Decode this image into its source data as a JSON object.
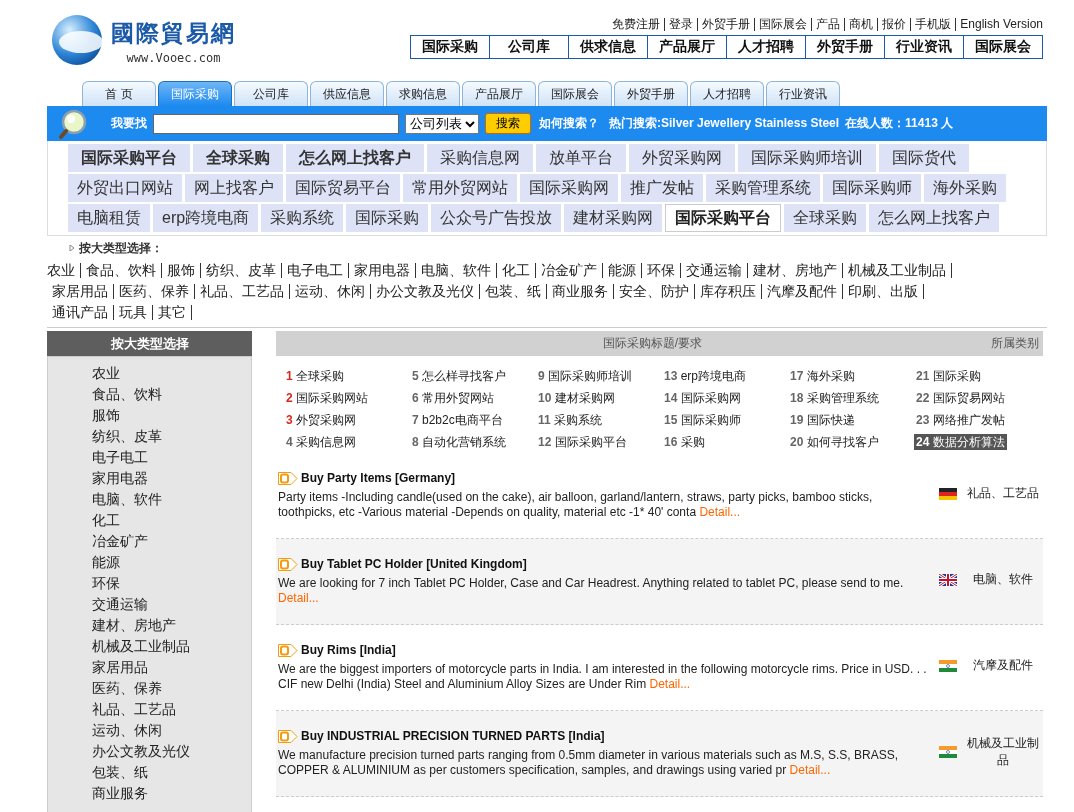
{
  "logo": {
    "title": "國際貿易網",
    "url": "www.Vooec.com"
  },
  "top_links": [
    "免费注册",
    "登录",
    "外贸手册",
    "国际展会",
    "产品",
    "商机",
    "报价",
    "手机版",
    "English Version"
  ],
  "main_nav": [
    "国际采购",
    "公司库",
    "供求信息",
    "产品展厅",
    "人才招聘",
    "外贸手册",
    "行业资讯",
    "国际展会"
  ],
  "tabs": [
    {
      "label": "首 页",
      "selected": false
    },
    {
      "label": "国际采购",
      "selected": true
    },
    {
      "label": "公司库",
      "selected": false
    },
    {
      "label": "供应信息",
      "selected": false
    },
    {
      "label": "求购信息",
      "selected": false
    },
    {
      "label": "产品展厅",
      "selected": false
    },
    {
      "label": "国际展会",
      "selected": false
    },
    {
      "label": "外贸手册",
      "selected": false
    },
    {
      "label": "人才招聘",
      "selected": false
    },
    {
      "label": "行业资讯",
      "selected": false
    }
  ],
  "search": {
    "label": "我要找",
    "select": "公司列表",
    "button": "搜索",
    "help": "如何搜索？",
    "hot": "热门搜索:Silver Jewellery  Stainless Steel",
    "online": "在线人数：11413 人"
  },
  "keyword_rows": [
    [
      {
        "label": "国际采购平台",
        "selected": false,
        "bold": true
      },
      {
        "label": "全球采购",
        "selected": false,
        "bold": true
      },
      {
        "label": "怎么网上找客户",
        "selected": false,
        "bold": true
      },
      {
        "label": "采购信息网",
        "selected": false,
        "bold": false
      },
      {
        "label": "放单平台",
        "selected": false,
        "bold": false
      },
      {
        "label": "外贸采购网",
        "selected": false,
        "bold": false
      },
      {
        "label": "国际采购师培训",
        "selected": false,
        "bold": false
      },
      {
        "label": "国际货代",
        "selected": false,
        "bold": false
      }
    ],
    [
      {
        "label": "外贸出口网站",
        "selected": false,
        "bold": false
      },
      {
        "label": "网上找客户",
        "selected": false,
        "bold": false
      },
      {
        "label": "国际贸易平台",
        "selected": false,
        "bold": false
      },
      {
        "label": "常用外贸网站",
        "selected": false,
        "bold": false
      },
      {
        "label": "国际采购网",
        "selected": false,
        "bold": false
      },
      {
        "label": "推广发帖",
        "selected": false,
        "bold": false
      },
      {
        "label": "采购管理系统",
        "selected": false,
        "bold": false
      },
      {
        "label": "国际采购师",
        "selected": false,
        "bold": false
      },
      {
        "label": "海外采购",
        "selected": false,
        "bold": false
      }
    ],
    [
      {
        "label": "电脑租赁",
        "selected": false,
        "bold": false
      },
      {
        "label": "erp跨境电商",
        "selected": false,
        "bold": false
      },
      {
        "label": "采购系统",
        "selected": false,
        "bold": false
      },
      {
        "label": "国际采购",
        "selected": false,
        "bold": false
      },
      {
        "label": "公众号广告投放",
        "selected": false,
        "bold": false
      },
      {
        "label": "建材采购网",
        "selected": false,
        "bold": false
      },
      {
        "label": "国际采购平台",
        "selected": true,
        "bold": true
      },
      {
        "label": "全球采购",
        "selected": false,
        "bold": false
      },
      {
        "label": "怎么网上找客户",
        "selected": false,
        "bold": false
      }
    ]
  ],
  "category_title": "按大类型选择：",
  "categories": [
    "农业",
    "食品、饮料",
    "服饰",
    "纺织、皮革",
    "电子电工",
    "家用电器",
    "电脑、软件",
    "化工",
    "冶金矿产",
    "能源",
    "环保",
    "交通运输",
    "建材、房地产",
    "机械及工业制品",
    "家居用品",
    "医药、保养",
    "礼品、工艺品",
    "运动、休闲",
    "办公文教及光仪",
    "包装、纸",
    "商业服务",
    "安全、防护",
    "库存积压",
    "汽摩及配件",
    "印刷、出版",
    "通讯产品",
    "玩具",
    "其它"
  ],
  "sidebar": {
    "title": "按大类型选择",
    "items": [
      "农业",
      "食品、饮料",
      "服饰",
      "纺织、皮革",
      "电子电工",
      "家用电器",
      "电脑、软件",
      "化工",
      "冶金矿产",
      "能源",
      "环保",
      "交通运输",
      "建材、房地产",
      "机械及工业制品",
      "家居用品",
      "医药、保养",
      "礼品、工艺品",
      "运动、休闲",
      "办公文教及光仪",
      "包装、纸",
      "商业服务"
    ]
  },
  "table": {
    "columns": [
      "国际采购标题/要求",
      "所属类别"
    ]
  },
  "hot_list": [
    {
      "num": "1",
      "label": "全球采购",
      "hot": true,
      "selected": false
    },
    {
      "num": "5",
      "label": "怎么样寻找客户",
      "hot": false,
      "selected": false
    },
    {
      "num": "9",
      "label": "国际采购师培训",
      "hot": false,
      "selected": false
    },
    {
      "num": "13",
      "label": "erp跨境电商",
      "hot": false,
      "selected": false
    },
    {
      "num": "17",
      "label": "海外采购",
      "hot": false,
      "selected": false
    },
    {
      "num": "21",
      "label": "国际采购",
      "hot": false,
      "selected": false
    },
    {
      "num": "2",
      "label": "国际采购网站",
      "hot": true,
      "selected": false
    },
    {
      "num": "6",
      "label": "常用外贸网站",
      "hot": false,
      "selected": false
    },
    {
      "num": "10",
      "label": "建材采购网",
      "hot": false,
      "selected": false
    },
    {
      "num": "14",
      "label": "国际采购网",
      "hot": false,
      "selected": false
    },
    {
      "num": "18",
      "label": "采购管理系统",
      "hot": false,
      "selected": false
    },
    {
      "num": "22",
      "label": "国际贸易网站",
      "hot": false,
      "selected": false
    },
    {
      "num": "3",
      "label": "外贸采购网",
      "hot": true,
      "selected": false
    },
    {
      "num": "7",
      "label": "b2b2c电商平台",
      "hot": false,
      "selected": false
    },
    {
      "num": "11",
      "label": "采购系统",
      "hot": false,
      "selected": false
    },
    {
      "num": "15",
      "label": "国际采购师",
      "hot": false,
      "selected": false
    },
    {
      "num": "19",
      "label": "国际快递",
      "hot": false,
      "selected": false
    },
    {
      "num": "23",
      "label": "网络推广发帖",
      "hot": false,
      "selected": false
    },
    {
      "num": "4",
      "label": "采购信息网",
      "hot": false,
      "selected": false
    },
    {
      "num": "8",
      "label": "自动化营销系统",
      "hot": false,
      "selected": false
    },
    {
      "num": "12",
      "label": "国际采购平台",
      "hot": false,
      "selected": false
    },
    {
      "num": "16",
      "label": "采购",
      "hot": false,
      "selected": false
    },
    {
      "num": "20",
      "label": "如何寻找客户",
      "hot": false,
      "selected": false
    },
    {
      "num": "24",
      "label": "数据分析算法",
      "hot": false,
      "selected": true
    }
  ],
  "listings": [
    {
      "title": "Buy Party Items [Germany]",
      "text": "Party items -Including candle(used on the cake), air balloon, garland/lantern, straws, party picks, bamboo sticks, toothpicks, etc -Various material -Depends on quality, material etc -1* 40' conta",
      "link": "Detail...",
      "kind": "de",
      "category": "礼品、工艺品"
    },
    {
      "title": "Buy Tablet PC Holder [United Kingdom]",
      "text": "We are looking for 7 inch Tablet PC Holder, Case and Car Headrest. Anything related to tablet PC, please send to me.",
      "link": "Detail...",
      "kind": "gb",
      "category": "电脑、软件"
    },
    {
      "title": "Buy Rims [India]",
      "text": "We are the biggest importers of motorcycle parts in India. I am interested in the following motorcycle rims. Price in USD. . . CIF new Delhi (India) Steel and Aluminium Alloy Sizes are Under Rim",
      "link": "Detail...",
      "kind": "in",
      "category": "汽摩及配件"
    },
    {
      "title": "Buy INDUSTRIAL PRECISION TURNED PARTS [India]",
      "text": "We manufacture precision turned parts ranging from 0.5mm diameter in various materials such as M.S, S.S, BRASS, COPPER & ALUMINIUM as per customers specification, samples, and drawings using varied pr",
      "link": "Detail...",
      "kind": "in",
      "category": "机械及工业制品"
    }
  ]
}
